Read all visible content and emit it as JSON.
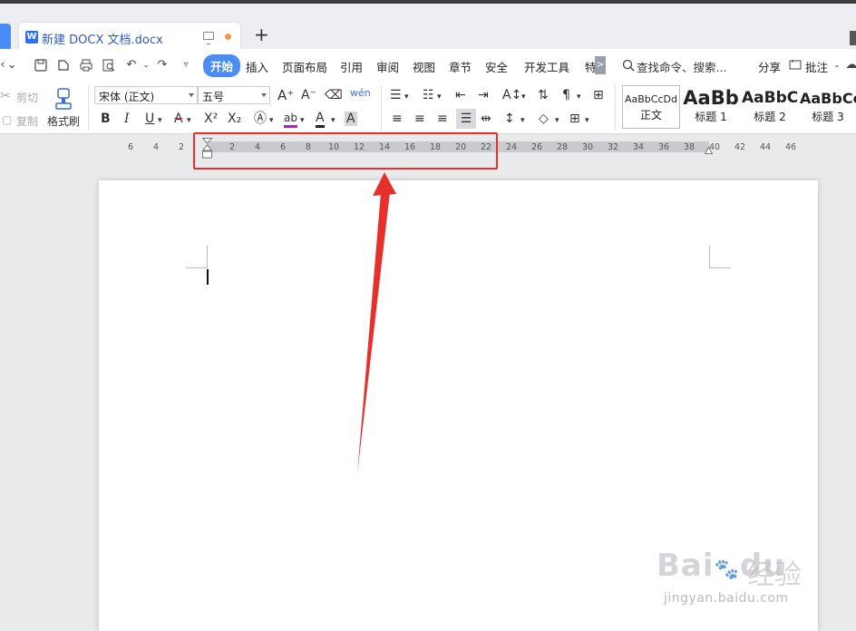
{
  "tabbar": {
    "doc_tab_title": "新建 DOCX 文档.docx",
    "doc_icon_letter": "W",
    "new_tab_label": "+"
  },
  "menu": {
    "items": [
      "开始",
      "插入",
      "页面布局",
      "引用",
      "审阅",
      "视图",
      "章节",
      "安全",
      "开发工具",
      "特"
    ],
    "active_item": "开始",
    "search_placeholder": "查找命令、搜索...",
    "share_label": "分享",
    "comment_label": "批注",
    "more_arrow": ">"
  },
  "ribbon": {
    "cut_label": "剪切",
    "copy_label": "复制",
    "format_painter_label": "格式刷",
    "font_name": "宋体 (正文)",
    "font_size": "五号",
    "bold": "B",
    "italic": "I",
    "underline": "U",
    "styles": [
      {
        "sample": "AaBbCcDd",
        "name": "正文"
      },
      {
        "sample": "AaBb",
        "name": "标题 1"
      },
      {
        "sample": "AaBbC",
        "name": "标题 2"
      },
      {
        "sample": "AaBbCc",
        "name": "标题 3"
      }
    ]
  },
  "ruler": {
    "left_labels": [
      "6",
      "4",
      "2"
    ],
    "labels": [
      "2",
      "4",
      "6",
      "8",
      "10",
      "12",
      "14",
      "16",
      "18",
      "20",
      "22",
      "24",
      "26",
      "28",
      "30",
      "32",
      "34",
      "36",
      "38",
      "40",
      "42",
      "44",
      "46"
    ]
  },
  "annotation": {
    "highlight_color": "#e8302a",
    "arrow_color": "#e8302a"
  },
  "watermark": {
    "logo_text": "Bai",
    "logo_suffix": "du",
    "cn_text": "经验",
    "url": "jingyan.baidu.com"
  },
  "colors": {
    "accent": "#4d8cf5",
    "tab_title": "#2b5bbd",
    "unsaved_dot": "#f39a4a"
  }
}
